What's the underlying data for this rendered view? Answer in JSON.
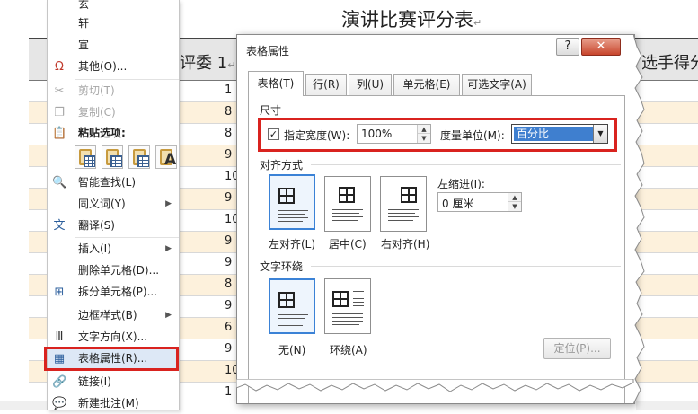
{
  "document": {
    "title": "演讲比赛评分表",
    "paragraph_mark": "↵",
    "header_left": "评委 1",
    "header_right": "选手得分",
    "visible_numbers": [
      "1",
      "8",
      "8",
      "9",
      "10",
      "9",
      "10",
      "9",
      "9",
      "8",
      "9",
      "6",
      "9",
      "10",
      "1"
    ]
  },
  "context_menu": {
    "top_items": [
      "玄",
      "轩",
      "宣"
    ],
    "items": [
      {
        "label": "其他(O)...",
        "icon": "insert-symbol-icon",
        "disabled": false
      },
      {
        "label": "剪切(T)",
        "icon": "scissors-icon",
        "disabled": true
      },
      {
        "label": "复制(C)",
        "icon": "copy-icon",
        "disabled": true
      },
      {
        "label": "粘贴选项:",
        "icon": "paste-icon",
        "disabled": false
      },
      {
        "label": "智能查找(L)",
        "icon": "search-icon",
        "disabled": false
      },
      {
        "label": "同义词(Y)",
        "icon": "",
        "disabled": false
      },
      {
        "label": "翻译(S)",
        "icon": "translate-icon",
        "disabled": false
      },
      {
        "label": "插入(I)",
        "icon": "",
        "disabled": false
      },
      {
        "label": "删除单元格(D)...",
        "icon": "",
        "disabled": false
      },
      {
        "label": "拆分单元格(P)...",
        "icon": "split-cells-icon",
        "disabled": false
      },
      {
        "label": "边框样式(B)",
        "icon": "",
        "disabled": false
      },
      {
        "label": "文字方向(X)...",
        "icon": "text-direction-icon",
        "disabled": false
      },
      {
        "label": "表格属性(R)...",
        "icon": "table-properties-icon",
        "disabled": false
      },
      {
        "label": "链接(I)",
        "icon": "link-icon",
        "disabled": false
      },
      {
        "label": "新建批注(M)",
        "icon": "comment-icon",
        "disabled": false
      }
    ],
    "submenu_arrow": "▶"
  },
  "dialog": {
    "title": "表格属性",
    "help_label": "?",
    "close_label": "✕",
    "tabs": [
      "表格(T)",
      "行(R)",
      "列(U)",
      "单元格(E)",
      "可选文字(A)"
    ],
    "active_tab": "表格(T)",
    "size_section": "尺寸",
    "specify_width_label": "指定宽度(W):",
    "specify_width_checked": true,
    "width_value": "100%",
    "unit_label": "度量单位(M):",
    "unit_value": "百分比",
    "alignment_section": "对齐方式",
    "alignment_options": [
      "左对齐(L)",
      "居中(C)",
      "右对齐(H)"
    ],
    "alignment_selected": "左对齐(L)",
    "indent_label": "左缩进(I):",
    "indent_value": "0 厘米",
    "wrap_section": "文字环绕",
    "wrap_options": [
      "无(N)",
      "环绕(A)"
    ],
    "wrap_selected": "无(N)",
    "position_button": "定位(P)..."
  },
  "colors": {
    "highlight_red": "#d9231f",
    "selected_blue": "#3b82d6",
    "row_tint": "#fdf1dc",
    "header_gray": "#e6e6e6"
  }
}
